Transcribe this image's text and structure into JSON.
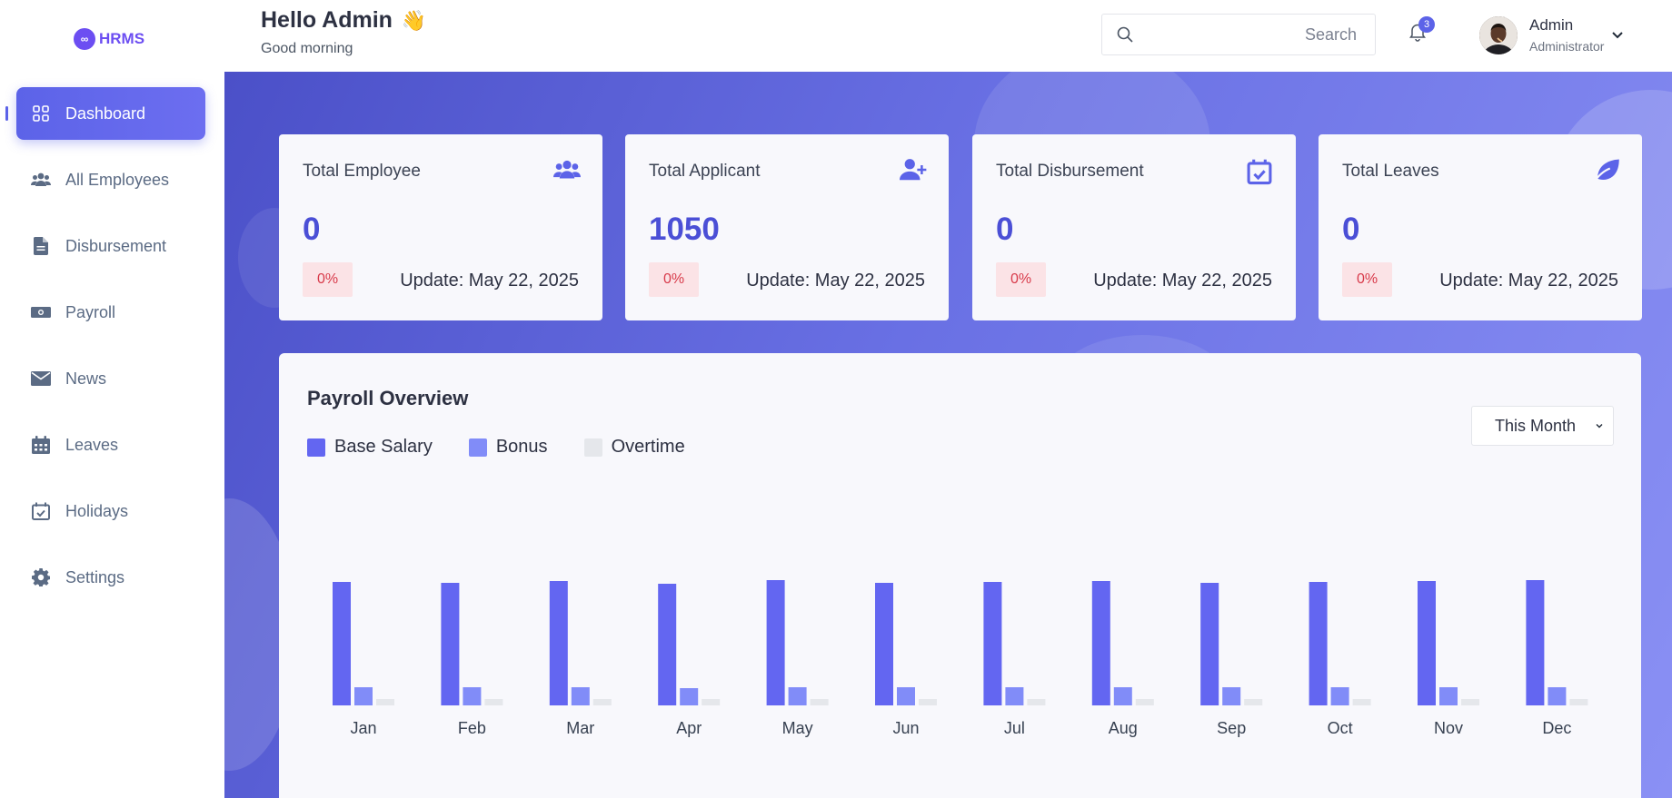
{
  "app": {
    "logo_badge": "∞",
    "logo_text": "HRMS"
  },
  "sidebar": {
    "items": [
      {
        "label": "Dashboard",
        "icon": "grid-icon",
        "active": true
      },
      {
        "label": "All Employees",
        "icon": "users-icon",
        "active": false
      },
      {
        "label": "Disbursement",
        "icon": "document-icon",
        "active": false
      },
      {
        "label": "Payroll",
        "icon": "money-icon",
        "active": false
      },
      {
        "label": "News",
        "icon": "envelope-icon",
        "active": false
      },
      {
        "label": "Leaves",
        "icon": "calendar-icon",
        "active": false
      },
      {
        "label": "Holidays",
        "icon": "calendar-check-icon",
        "active": false
      },
      {
        "label": "Settings",
        "icon": "gear-icon",
        "active": false
      }
    ]
  },
  "header": {
    "title": "Hello Admin",
    "wave": "👋",
    "subtitle": "Good morning",
    "search_placeholder": "Search",
    "notifications": "3",
    "user_name": "Admin",
    "user_role": "Administrator"
  },
  "cards": [
    {
      "title": "Total Employee",
      "value": "0",
      "change": "0%",
      "update": "Update: May 22, 2025",
      "icon": "users-icon"
    },
    {
      "title": "Total Applicant",
      "value": "1050",
      "change": "0%",
      "update": "Update: May 22, 2025",
      "icon": "user-plus-icon"
    },
    {
      "title": "Total Disbursement",
      "value": "0",
      "change": "0%",
      "update": "Update: May 22, 2025",
      "icon": "calendar-check-icon"
    },
    {
      "title": "Total Leaves",
      "value": "0",
      "change": "0%",
      "update": "Update: May 22, 2025",
      "icon": "leaf-icon"
    }
  ],
  "payroll": {
    "title": "Payroll Overview",
    "period": "This Month",
    "colors": {
      "base": "#6366f1",
      "bonus": "#818cf8",
      "overtime": "#e5e7eb"
    }
  },
  "chart_data": {
    "type": "bar",
    "title": "Payroll Overview",
    "categories": [
      "Jan",
      "Feb",
      "Mar",
      "Apr",
      "May",
      "Jun",
      "Jul",
      "Aug",
      "Sep",
      "Oct",
      "Nov",
      "Dec"
    ],
    "series": [
      {
        "name": "Base Salary",
        "values": [
          136,
          135,
          137,
          134,
          138,
          135,
          136,
          137,
          135,
          136,
          137,
          138
        ]
      },
      {
        "name": "Bonus",
        "values": [
          20,
          20,
          20,
          19,
          20,
          20,
          20,
          20,
          20,
          20,
          20,
          20
        ]
      },
      {
        "name": "Overtime",
        "values": [
          7,
          7,
          7,
          7,
          7,
          7,
          7,
          7,
          7,
          7,
          7,
          7
        ]
      }
    ],
    "grid": false,
    "legend": "top-left"
  }
}
